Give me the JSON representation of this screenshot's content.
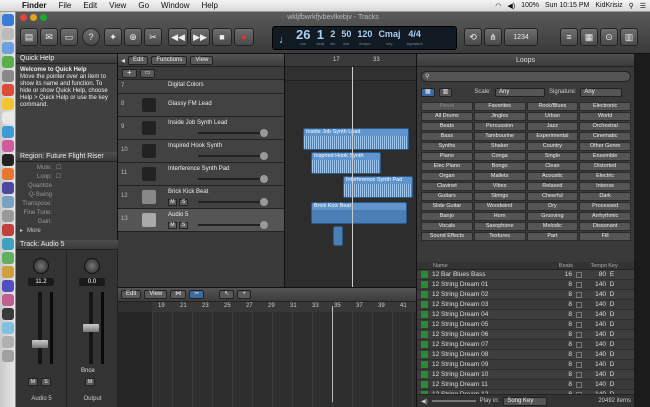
{
  "menubar": {
    "app": "Finder",
    "items": [
      "File",
      "Edit",
      "View",
      "Go",
      "Window",
      "Help"
    ],
    "clock": "Sun 10:15 PM",
    "user": "KidKrisiz",
    "battery": "100%"
  },
  "window": {
    "title": "wkljfbwrkfjvbevlkebjv - Tracks"
  },
  "lcd": {
    "bar": "26",
    "bar_label": "bar",
    "beat": "1",
    "beat_label": "beat",
    "div": "2",
    "div_label": "div",
    "tick": "50",
    "tick_label": "tick",
    "tempo": "120",
    "tempo_label": "tempo",
    "key": "Cmaj",
    "key_label": "key",
    "sig": "4/4",
    "sig_label": "signature"
  },
  "toolbar": {
    "count_label": "1234"
  },
  "inspector": {
    "quickhelp_title": "Quick Help",
    "quickhelp_heading": "Welcome to Quick Help",
    "quickhelp_text": "Move the pointer over an item to show its name and function. To hide or show Quick Help, choose Help > Quick Help or use the key command.",
    "region_title": "Region: Future Flight Riser",
    "region_rows": [
      {
        "label": "Mute:"
      },
      {
        "label": "Loop:"
      },
      {
        "label": "Quantize"
      },
      {
        "label": "Q-Swing"
      },
      {
        "label": "Transpose:"
      },
      {
        "label": "Fine Tune:"
      },
      {
        "label": "Gain:"
      }
    ],
    "more_label": "More",
    "track_title": "Track:  Audio 5",
    "strips": [
      {
        "value": "11.2",
        "name": "Audio 5",
        "mute": "M",
        "solo": "S"
      },
      {
        "value": "0.0",
        "name": "Output",
        "mute": "M",
        "bnce": "Bnce"
      }
    ]
  },
  "tracks": {
    "toolbar": {
      "edit": "Edit",
      "functions": "Functions",
      "view": "View"
    },
    "ruler": [
      "17",
      "33"
    ],
    "rows": [
      {
        "num": "7",
        "name": "Digital Colors"
      },
      {
        "num": "8",
        "name": "Glassy FM Lead"
      },
      {
        "num": "9",
        "name": "Inside Job Synth Lead"
      },
      {
        "num": "10",
        "name": "Inspired Hook Synth"
      },
      {
        "num": "11",
        "name": "Interference Synth Pad"
      },
      {
        "num": "12",
        "name": "Brick Kick Beat"
      },
      {
        "num": "13",
        "name": "Audio 5"
      }
    ],
    "mute": "M",
    "solo": "S",
    "regions": [
      {
        "label": "Inside Job Synth Lead",
        "row": 2
      },
      {
        "label": "Inspired Hook Synth",
        "row": 3
      },
      {
        "label": "Interference Synth Pad",
        "row": 4
      },
      {
        "label": "Brick Kick Beat",
        "row": 5
      }
    ]
  },
  "editor": {
    "edit": "Edit",
    "view": "View",
    "ruler": [
      "19",
      "21",
      "23",
      "25",
      "27",
      "29",
      "31",
      "33",
      "35",
      "37",
      "39",
      "41"
    ]
  },
  "loops": {
    "title": "Loops",
    "scale_label": "Scale:",
    "scale_value": "Any",
    "sig_label": "Signature:",
    "sig_value": "Any",
    "keywords": [
      "Reset",
      "Favorites",
      "Rock/Blues",
      "Electronic",
      "All Drums",
      "Jingles",
      "Urban",
      "World",
      "Beats",
      "Percussion",
      "Jazz",
      "Orchestral",
      "Bass",
      "Tambourine",
      "Experimental",
      "Cinematic",
      "Synths",
      "Shaker",
      "Country",
      "Other Genre",
      "Piano",
      "Conga",
      "Single",
      "Ensemble",
      "Elec Piano",
      "Bongo",
      "Clean",
      "Distorted",
      "Organ",
      "Mallets",
      "Acoustic",
      "Electric",
      "Clavinet",
      "Vibes",
      "Relaxed",
      "Intense",
      "Guitars",
      "Strings",
      "Cheerful",
      "Dark",
      "Slide Guitar",
      "Woodwind",
      "Dry",
      "Processed",
      "Banjo",
      "Horn",
      "Grooving",
      "Arrhythmic",
      "Vocals",
      "Saxophone",
      "Melodic",
      "Dissonant",
      "Sound Effects",
      "Textures",
      "Part",
      "Fill"
    ],
    "columns": {
      "name": "Name",
      "beats": "Beats",
      "tempo": "Tempo",
      "key": "Key"
    },
    "rows": [
      {
        "name": "12 Bar Blues Bass",
        "beats": "16",
        "tempo": "80",
        "key": "E"
      },
      {
        "name": "12 String Dream 01",
        "beats": "8",
        "tempo": "140",
        "key": "D"
      },
      {
        "name": "12 String Dream 02",
        "beats": "8",
        "tempo": "140",
        "key": "D"
      },
      {
        "name": "12 String Dream 03",
        "beats": "8",
        "tempo": "140",
        "key": "D"
      },
      {
        "name": "12 String Dream 04",
        "beats": "8",
        "tempo": "140",
        "key": "D"
      },
      {
        "name": "12 String Dream 05",
        "beats": "8",
        "tempo": "140",
        "key": "D"
      },
      {
        "name": "12 String Dream 06",
        "beats": "8",
        "tempo": "140",
        "key": "D"
      },
      {
        "name": "12 String Dream 07",
        "beats": "8",
        "tempo": "140",
        "key": "D"
      },
      {
        "name": "12 String Dream 08",
        "beats": "8",
        "tempo": "140",
        "key": "D"
      },
      {
        "name": "12 String Dream 09",
        "beats": "8",
        "tempo": "140",
        "key": "D"
      },
      {
        "name": "12 String Dream 10",
        "beats": "8",
        "tempo": "140",
        "key": "D"
      },
      {
        "name": "12 String Dream 11",
        "beats": "8",
        "tempo": "140",
        "key": "D"
      },
      {
        "name": "12 String Dream 12",
        "beats": "8",
        "tempo": "140",
        "key": "D"
      }
    ],
    "play_in_label": "Play in:",
    "play_in_value": "Song Key",
    "count": "20492 items"
  }
}
